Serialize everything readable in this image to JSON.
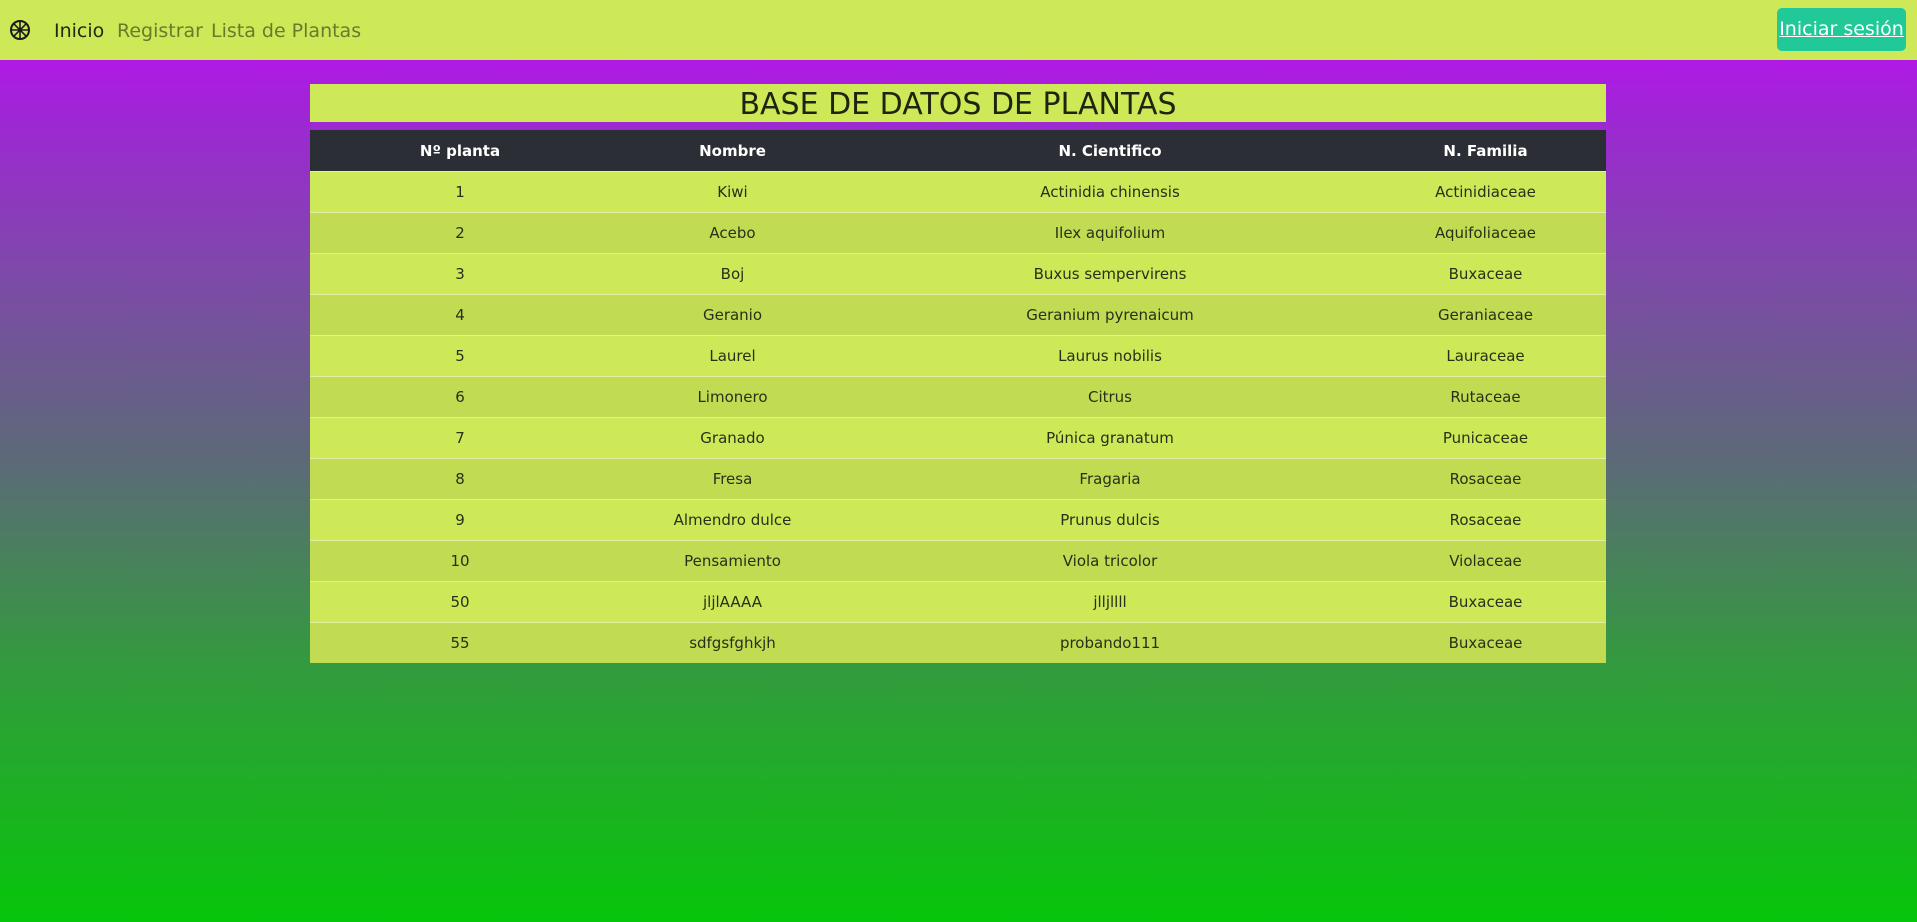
{
  "navbar": {
    "brand_icon": "wheel-icon",
    "links": [
      {
        "label": "Inicio",
        "active": true
      },
      {
        "label": "Registrar",
        "active": false
      },
      {
        "label": "Lista de Plantas",
        "active": false
      }
    ],
    "login_label": "Iniciar sesión"
  },
  "page": {
    "title": "BASE DE DATOS DE PLANTAS"
  },
  "table": {
    "headers": [
      "Nº planta",
      "Nombre",
      "N. Cientifico",
      "N. Familia"
    ],
    "rows": [
      [
        "1",
        "Kiwi",
        "Actinidia chinensis",
        "Actinidiaceae"
      ],
      [
        "2",
        "Acebo",
        "Ilex aquifolium",
        "Aquifoliaceae"
      ],
      [
        "3",
        "Boj",
        "Buxus sempervirens",
        "Buxaceae"
      ],
      [
        "4",
        "Geranio",
        "Geranium pyrenaicum",
        "Geraniaceae"
      ],
      [
        "5",
        "Laurel",
        "Laurus nobilis",
        "Lauraceae"
      ],
      [
        "6",
        "Limonero",
        "Citrus",
        "Rutaceae"
      ],
      [
        "7",
        "Granado",
        "Púnica granatum",
        "Punicaceae"
      ],
      [
        "8",
        "Fresa",
        "Fragaria",
        "Rosaceae"
      ],
      [
        "9",
        "Almendro dulce",
        "Prunus dulcis",
        "Rosaceae"
      ],
      [
        "10",
        "Pensamiento",
        "Viola tricolor",
        "Violaceae"
      ],
      [
        "50",
        "jljlAAAA",
        "jlljllll",
        "Buxaceae"
      ],
      [
        "55",
        "sdfgsfghkjh",
        "probando111",
        "Buxaceae"
      ]
    ]
  },
  "colors": {
    "navbar_bg": "#cde958",
    "login_bg": "#20c997",
    "table_header_bg": "#2b2f35",
    "gradient_top": "#c20cf5",
    "gradient_bottom": "#06c60a"
  }
}
